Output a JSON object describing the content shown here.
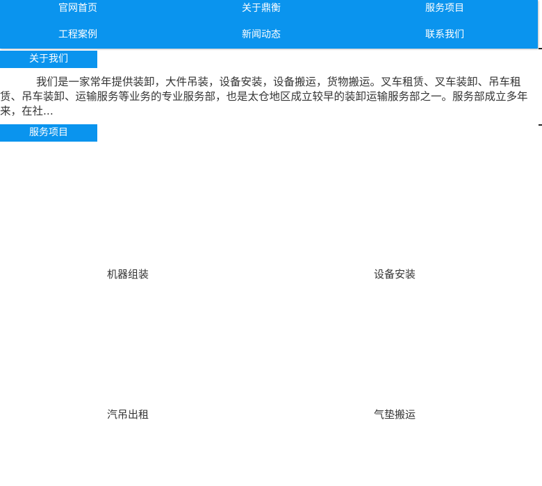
{
  "nav": {
    "items": [
      {
        "label": "官网首页"
      },
      {
        "label": "关于鼎衡"
      },
      {
        "label": "服务项目"
      },
      {
        "label": "工程案例"
      },
      {
        "label": "新闻动态"
      },
      {
        "label": "联系我们"
      }
    ]
  },
  "about": {
    "heading": "关于我们",
    "text": "我们是一家常年提供装卸，大件吊装，设备安装，设备搬运，货物搬运。叉车租赁、叉车装卸、吊车租赁、吊车装卸、运输服务等业务的专业服务部，也是太仓地区成立较早的装卸运输服务部之一。服务部成立多年来，在社..."
  },
  "services": {
    "heading": "服务项目",
    "items": [
      {
        "label": "机器组装"
      },
      {
        "label": "设备安装"
      },
      {
        "label": "汽吊出租"
      },
      {
        "label": "气垫搬运"
      }
    ]
  },
  "colors": {
    "accent": "#0a94ee",
    "text": "#333333"
  }
}
